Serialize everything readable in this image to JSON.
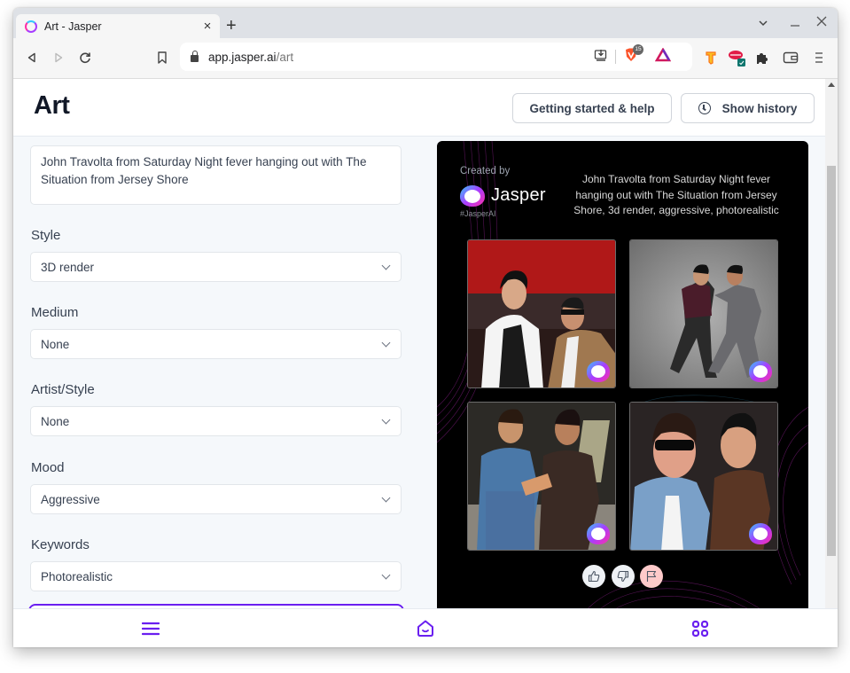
{
  "browser": {
    "tab_title": "Art - Jasper",
    "tab_close": "×",
    "new_tab": "+",
    "url_host": "app.jasper.ai",
    "url_path": "/art",
    "brave_badge_count": "15",
    "window_controls": {
      "dropdown": "⌄",
      "minimize": "–",
      "close": "✕"
    }
  },
  "header": {
    "title": "Art",
    "help_button": "Getting started & help",
    "history_button": "Show history"
  },
  "form": {
    "prompt": "John Travolta from Saturday Night fever hanging out with The Situation from Jersey Shore",
    "fields": [
      {
        "label": "Style",
        "value": "3D render"
      },
      {
        "label": "Medium",
        "value": "None"
      },
      {
        "label": "Artist/Style",
        "value": "None"
      },
      {
        "label": "Mood",
        "value": "Aggressive"
      },
      {
        "label": "Keywords",
        "value": "Photorealistic"
      }
    ]
  },
  "art_card": {
    "created_by": "Created by",
    "brand": "Jasper",
    "hashtag": "#JasperAI",
    "caption": "John Travolta from Saturday Night fever hanging out with The Situation from Jersey Shore, 3d render, aggressive, photorealistic",
    "images": [
      {
        "alt": "Two men in 70s disco club, red background, one in sunglasses"
      },
      {
        "alt": "Two men dancing against grey background"
      },
      {
        "alt": "Man in blue sweater and man in leather jacket"
      },
      {
        "alt": "Man in sunglasses and denim shirt with man in brown shirt"
      }
    ],
    "feedback": [
      "thumbs-up",
      "thumbs-down",
      "flag"
    ]
  },
  "colors": {
    "accent": "#6a1ff0",
    "page_bg": "#f5f8fb",
    "card_bg": "#000000",
    "flag_bg": "#fecaca"
  },
  "bottom_nav": [
    "menu",
    "home",
    "apps"
  ]
}
